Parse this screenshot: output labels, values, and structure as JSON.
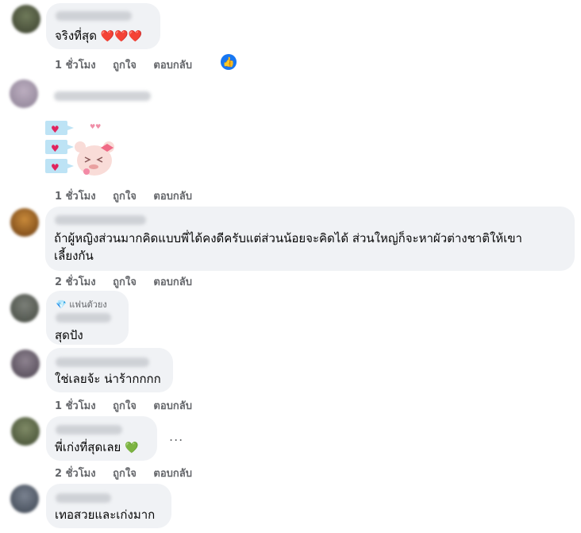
{
  "colors": {
    "bubble_bg": "#f0f2f5",
    "action_text": "#65676b",
    "like_blue": "#1877f2",
    "heart_red": "#e0245e",
    "heart_green": "#63d13e"
  },
  "icons": {
    "like": "thumbs-up-icon",
    "more": "more-options-icon",
    "fan": "diamond-icon",
    "heart_red": "heart-red-emoji",
    "heart_green": "heart-green-emoji",
    "sticker": "bear-heart-sticker"
  },
  "comments": [
    {
      "text": "จริงที่สุด",
      "hearts": "❤️❤️❤️",
      "time": "1 ชั่วโมง",
      "like": "ถูกใจ",
      "reply": "ตอบกลับ"
    },
    {
      "sticker": true,
      "time": "1 ชั่วโมง",
      "like": "ถูกใจ",
      "reply": "ตอบกลับ"
    },
    {
      "text_line1": "ถ้าผู้หญิงส่วนมากคิดแบบพี่ได้คงดีครับแต่ส่วนน้อยจะคิดได้ ส่วนใหญ่ก็จะหาผัวต่างชาติให้เขา",
      "text_line2": "เลี้ยงกัน",
      "time": "2 ชั่วโมง",
      "like": "ถูกใจ",
      "reply": "ตอบกลับ"
    },
    {
      "fan_label": "แฟนตัวยง",
      "text": "สุดปัง"
    },
    {
      "text": "ใช่เลยจ้ะ น่าร้ากกกก",
      "time": "1 ชั่วโมง",
      "like": "ถูกใจ",
      "reply": "ตอบกลับ"
    },
    {
      "text": "พี่เก่งที่สุดเลย",
      "heart": "💚",
      "more": "...",
      "time": "2 ชั่วโมง",
      "like": "ถูกใจ",
      "reply": "ตอบกลับ"
    },
    {
      "text": "เทอสวยและเก่งมาก"
    }
  ]
}
